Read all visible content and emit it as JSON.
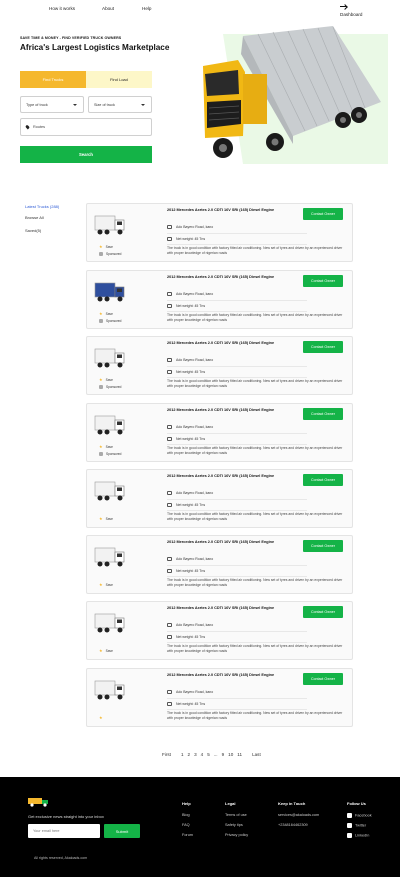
{
  "nav": {
    "how_it_works": "How it works",
    "about": "About",
    "help": "Help",
    "dashboard": "Dashboard"
  },
  "hero": {
    "tagline": "SAVE TIME & MONEY - FIND VERIFIED TRUCK OWNERS",
    "headline": "Africa's Largest Logistics Marketplace"
  },
  "search": {
    "tab_find_trucks": "Find Trucks",
    "tab_find_load": "Find Load",
    "type_of_truck": "Type of truck",
    "size_of_truck": "Size of truck",
    "routes_placeholder": "Routes",
    "button": "Search"
  },
  "sidebar": {
    "latest": "Latest Trucks (288)",
    "browse": "Browse All",
    "saved": "Saved(5)"
  },
  "listings": [
    {
      "title": "2012 Mercedes Axrtes 2.0 CDTI 16V SRi (165) Diesel Engine",
      "location": "Ado Bayero Road, kano",
      "weight": "Net weight: 45 Tns",
      "description": "The truck is in good condition with factory fitted air conditioning. New set of tyres and driven by an experienced driver with proper knowledge of nigerian roads",
      "save": "Save",
      "sponsored": "Sponsored",
      "button": "Contact Owner",
      "truck_color": "#ffffff"
    },
    {
      "title": "2012 Mercedes Axrtes 2.0 CDTI 16V SRi (165) Diesel Engine",
      "location": "Ado Bayero Road, kano",
      "weight": "Net weight: 45 Tns",
      "description": "The truck is in good condition with factory fitted air conditioning. New set of tyres and driven by an experienced driver with proper knowledge of nigerian roads",
      "save": "Save",
      "sponsored": "Sponsored",
      "button": "Contact Owner",
      "truck_color": "#2f4f9e"
    },
    {
      "title": "2012 Mercedes Axrtes 2.0 CDTI 16V SRi (165) Diesel Engine",
      "location": "Ado Bayero Road, kano",
      "weight": "Net weight: 45 Tns",
      "description": "The truck is in good condition with factory fitted air conditioning. New set of tyres and driven by an experienced driver with proper knowledge of nigerian roads",
      "save": "Save",
      "sponsored": "Sponsored",
      "button": "Contact Owner",
      "truck_color": "#ffffff"
    },
    {
      "title": "2012 Mercedes Axrtes 2.0 CDTI 16V SRi (165) Diesel Engine",
      "location": "Ado Bayero Road, kano",
      "weight": "Net weight: 45 Tns",
      "description": "The truck is in good condition with factory fitted air conditioning. New set of tyres and driven by an experienced driver with proper knowledge of nigerian roads",
      "save": "Save",
      "sponsored": "Sponsored",
      "button": "Contact Owner",
      "truck_color": "#ffffff"
    },
    {
      "title": "2012 Mercedes Axrtes 2.0 CDTI 16V SRi (165) Diesel Engine",
      "location": "Ado Bayero Road, kano",
      "weight": "Net weight: 45 Tns",
      "description": "The truck is in good condition with factory fitted air conditioning. New set of tyres and driven by an experienced driver with proper knowledge of nigerian roads",
      "save": "Save",
      "sponsored": "",
      "button": "Contact Owner",
      "truck_color": "#ffffff"
    },
    {
      "title": "2012 Mercedes Axrtes 2.0 CDTI 16V SRi (165) Diesel Engine",
      "location": "Ado Bayero Road, kano",
      "weight": "Net weight: 45 Tns",
      "description": "The truck is in good condition with factory fitted air conditioning. New set of tyres and driven by an experienced driver with proper knowledge of nigerian roads",
      "save": "Save",
      "sponsored": "",
      "button": "Contact Owner",
      "truck_color": "#ffffff"
    },
    {
      "title": "2012 Mercedes Axrtes 2.0 CDTI 16V SRi (165) Diesel Engine",
      "location": "Ado Bayero Road, kano",
      "weight": "Net weight: 45 Tns",
      "description": "The truck is in good condition with factory fitted air conditioning. New set of tyres and driven by an experienced driver with proper knowledge of nigerian roads",
      "save": "Save",
      "sponsored": "",
      "button": "Contact Owner",
      "truck_color": "#ffffff"
    },
    {
      "title": "2012 Mercedes Axrtes 2.0 CDTI 16V SRi (165) Diesel Engine",
      "location": "Ado Bayero Road, kano",
      "weight": "Net weight: 45 Tns",
      "description": "The truck is in good condition with factory fitted air conditioning. New set of tyres and driven by an experienced driver with proper knowledge of nigerian roads",
      "save": "",
      "sponsored": "",
      "button": "Contact Owner",
      "truck_color": "#ffffff"
    }
  ],
  "pagination": {
    "first": "First",
    "pages": [
      "1",
      "2",
      "3",
      "4",
      "5"
    ],
    "ellipsis": "...",
    "more": [
      "9",
      "10",
      "11"
    ],
    "last": "Last"
  },
  "footer": {
    "subscribe_text": "Get exclusive news straight into your inbox",
    "email_placeholder": "Your email here",
    "subscribe_button": "Submit",
    "rights": "All rights reserved, Akaloads.com",
    "help": {
      "heading": "Help",
      "links": [
        "Blog",
        "FAQ",
        "Forum"
      ]
    },
    "legal": {
      "heading": "Legal",
      "links": [
        "Terms of use",
        "Safety tips",
        "Privacy policy"
      ]
    },
    "contact": {
      "heading": "Keep in Touch",
      "links": [
        "services@akaloads.com",
        "+2348164462309"
      ]
    },
    "follow": {
      "heading": "Follow Us",
      "links": [
        "Facebook",
        "Twitter",
        "LinkedIn"
      ]
    }
  },
  "colors": {
    "accent_green": "#14b347",
    "accent_yellow": "#f5b82e"
  }
}
